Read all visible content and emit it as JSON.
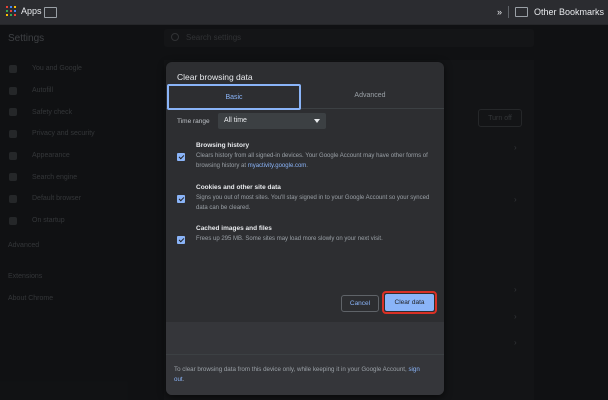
{
  "bookmarks": {
    "apps_label": "Apps",
    "other_label": "Other Bookmarks",
    "overflow": "»"
  },
  "settings": {
    "title": "Settings",
    "search_placeholder": "Search settings",
    "sidebar": [
      "You and Google",
      "Autofill",
      "Safety check",
      "Privacy and security",
      "Appearance",
      "Search engine",
      "Default browser",
      "On startup"
    ],
    "advanced": "Advanced",
    "extensions": "Extensions",
    "about": "About Chrome",
    "turn_off": "Turn off"
  },
  "dialog": {
    "title": "Clear browsing data",
    "tabs": {
      "basic": "Basic",
      "advanced": "Advanced"
    },
    "time_range": {
      "label": "Time range",
      "value": "All time"
    },
    "options": [
      {
        "title": "Browsing history",
        "desc_pre": "Clears history from all signed-in devices. Your Google Account may have other forms of browsing history at ",
        "link": "myactivity.google.com",
        "desc_post": ".",
        "checked": true
      },
      {
        "title": "Cookies and other site data",
        "desc_pre": "Signs you out of most sites. You'll stay signed in to your Google Account so your synced data can be cleared.",
        "link": "",
        "desc_post": "",
        "checked": true
      },
      {
        "title": "Cached images and files",
        "desc_pre": "Frees up 295 MB. Some sites may load more slowly on your next visit.",
        "link": "",
        "desc_post": "",
        "checked": true
      }
    ],
    "cancel": "Cancel",
    "clear": "Clear data",
    "footer_pre": "To clear browsing data from this device only, while keeping it in your Google Account, ",
    "footer_link": "sign out",
    "footer_post": "."
  },
  "colors": {
    "accent": "#8ab4f8",
    "highlight": "#d93025"
  }
}
